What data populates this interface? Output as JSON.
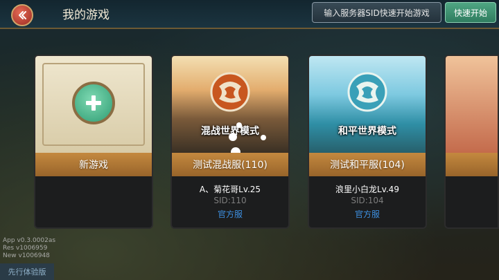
{
  "header": {
    "title": "我的游戏",
    "sid_button": "输入服务器SID快速开始游戏",
    "quick_start_button": "快速开始"
  },
  "cards": [
    {
      "bar_label": "新游戏",
      "icon": "plus-icon"
    },
    {
      "mode_label": "混战世界模式",
      "bar_label": "测试混战服(110)",
      "player": "A、菊花哥Lv.25",
      "sid": "SID:110",
      "tag": "官方服",
      "icon": "dragon-globe-icon"
    },
    {
      "mode_label": "和平世界模式",
      "bar_label": "测试和平服(104)",
      "player": "浪里小白龙Lv.49",
      "sid": "SID:104",
      "tag": "官方服",
      "icon": "dragon-globe-icon"
    }
  ],
  "version": {
    "app": "App  v0.3.0002as",
    "res": "Res   v1006959",
    "new": "New v1006948"
  },
  "bottom_tag": "先行体验版",
  "colors": {
    "accent_orange": "#c4893f",
    "quick_start_green": "#3f9a77",
    "link_blue": "#3d8fe0"
  }
}
